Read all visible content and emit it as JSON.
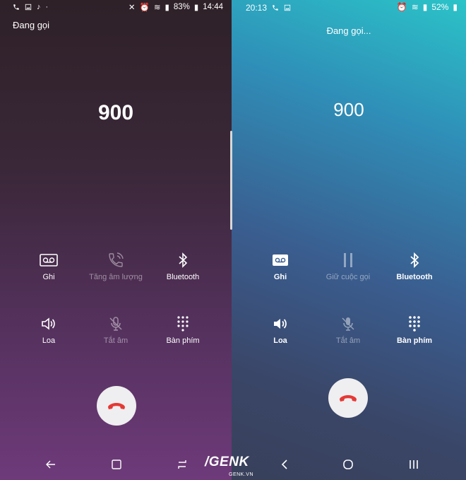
{
  "left": {
    "status": {
      "battery": "83%",
      "time": "14:44"
    },
    "calling_label": "Đang gọi",
    "number": "900",
    "buttons": [
      {
        "label": "Ghi",
        "icon": "voicemail-record-icon",
        "enabled": true
      },
      {
        "label": "Tăng âm lượng",
        "icon": "volume-boost-phone-icon",
        "enabled": false
      },
      {
        "label": "Bluetooth",
        "icon": "bluetooth-icon",
        "enabled": true
      },
      {
        "label": "Loa",
        "icon": "speaker-icon",
        "enabled": true
      },
      {
        "label": "Tắt âm",
        "icon": "mute-mic-icon",
        "enabled": false
      },
      {
        "label": "Bàn phím",
        "icon": "dialpad-icon",
        "enabled": true
      }
    ],
    "end_call_color": "#e53935"
  },
  "right": {
    "status": {
      "time": "20:13",
      "battery": "52%"
    },
    "calling_label": "Đang gọi...",
    "number": "900",
    "buttons": [
      {
        "label": "Ghi",
        "icon": "voicemail-record-icon",
        "enabled": true
      },
      {
        "label": "Giữ cuộc gọi",
        "icon": "pause-icon",
        "enabled": false
      },
      {
        "label": "Bluetooth",
        "icon": "bluetooth-icon",
        "enabled": true
      },
      {
        "label": "Loa",
        "icon": "speaker-icon",
        "enabled": true
      },
      {
        "label": "Tắt âm",
        "icon": "mute-mic-icon",
        "enabled": false
      },
      {
        "label": "Bàn phím",
        "icon": "dialpad-icon",
        "enabled": true
      }
    ],
    "end_call_color": "#e53935"
  },
  "watermark": {
    "brand": "/GENK",
    "site": "GENK.VN"
  }
}
